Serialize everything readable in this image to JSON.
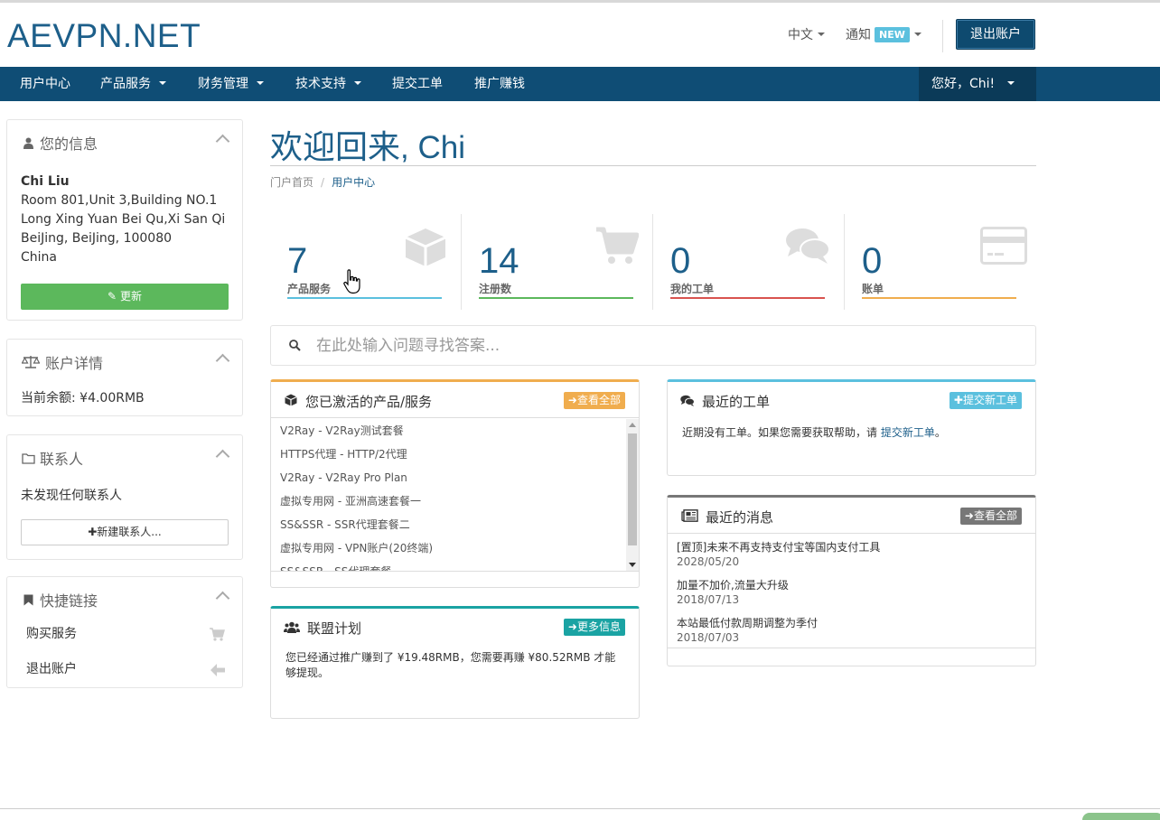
{
  "header": {
    "logo": "AEVPN.NET",
    "language": "中文",
    "notifications": "通知",
    "new_badge": "NEW",
    "logout": "退出账户"
  },
  "nav": {
    "items": [
      {
        "label": "用户中心",
        "dropdown": false
      },
      {
        "label": "产品服务",
        "dropdown": true
      },
      {
        "label": "财务管理",
        "dropdown": true
      },
      {
        "label": "技术支持",
        "dropdown": true
      },
      {
        "label": "提交工单",
        "dropdown": false
      },
      {
        "label": "推广赚钱",
        "dropdown": false
      }
    ],
    "user_greeting": "您好，Chi!"
  },
  "sidebar": {
    "info": {
      "title": "您的信息",
      "name": "Chi Liu",
      "address": [
        "Room 801,Unit 3,Building NO.1",
        "Long Xing Yuan Bei Qu,Xi San Qi",
        "BeiJing, BeiJing, 100080",
        "China"
      ],
      "update_button": "更新"
    },
    "account": {
      "title": "账户详情",
      "balance": "当前余额: ¥4.00RMB"
    },
    "contacts": {
      "title": "联系人",
      "empty": "未发现任何联系人",
      "new_button": "新建联系人..."
    },
    "quicklinks": {
      "title": "快捷链接",
      "items": [
        {
          "label": "购买服务",
          "icon": "cart-icon"
        },
        {
          "label": "退出账户",
          "icon": "arrow-left-icon"
        }
      ]
    }
  },
  "main": {
    "welcome": "欢迎回来",
    "welcome_name": ", Chi",
    "breadcrumb": {
      "home": "门户首页",
      "current": "用户中心"
    },
    "stats": [
      {
        "value": "7",
        "label": "产品服务",
        "color": "#5bc0de",
        "icon": "cube-icon"
      },
      {
        "value": "14",
        "label": "注册数",
        "color": "#5cb85c",
        "icon": "cart-icon"
      },
      {
        "value": "0",
        "label": "我的工单",
        "color": "#d9534f",
        "icon": "comments-icon"
      },
      {
        "value": "0",
        "label": "账单",
        "color": "#f0ad4e",
        "icon": "credit-card-icon"
      }
    ],
    "search_placeholder": "在此处输入问题寻找答案...",
    "services": {
      "title": "您已激活的产品/服务",
      "button": "查看全部",
      "accent": "#f0ad4e",
      "items": [
        "V2Ray - V2Ray测试套餐",
        "HTTPS代理 - HTTP/2代理",
        "V2Ray - V2Ray Pro Plan",
        "虚拟专用网 - 亚洲高速套餐一",
        "SS&SSR - SSR代理套餐二",
        "虚拟专用网 - VPN账户(20终端)",
        "SS&SSR - SS代理套餐"
      ]
    },
    "affiliate": {
      "title": "联盟计划",
      "button": "更多信息",
      "accent": "#1aa3a3",
      "text": "您已经通过推广赚到了 ¥19.48RMB，您需要再赚 ¥80.52RMB 才能够提现。"
    },
    "tickets": {
      "title": "最近的工单",
      "button": "提交新工单",
      "accent": "#5bc0de",
      "text_before": "近期没有工单。如果您需要获取帮助，请 ",
      "link": "提交新工单",
      "text_after": "。"
    },
    "news": {
      "title": "最近的消息",
      "button": "查看全部",
      "accent": "#777777",
      "items": [
        {
          "title": "[置顶]未来不再支持支付宝等国内支付工具",
          "date": "2028/05/20"
        },
        {
          "title": "加量不加价,流量大升级",
          "date": "2018/07/13"
        },
        {
          "title": "本站最低付款周期调整为季付",
          "date": "2018/07/03"
        }
      ]
    }
  }
}
